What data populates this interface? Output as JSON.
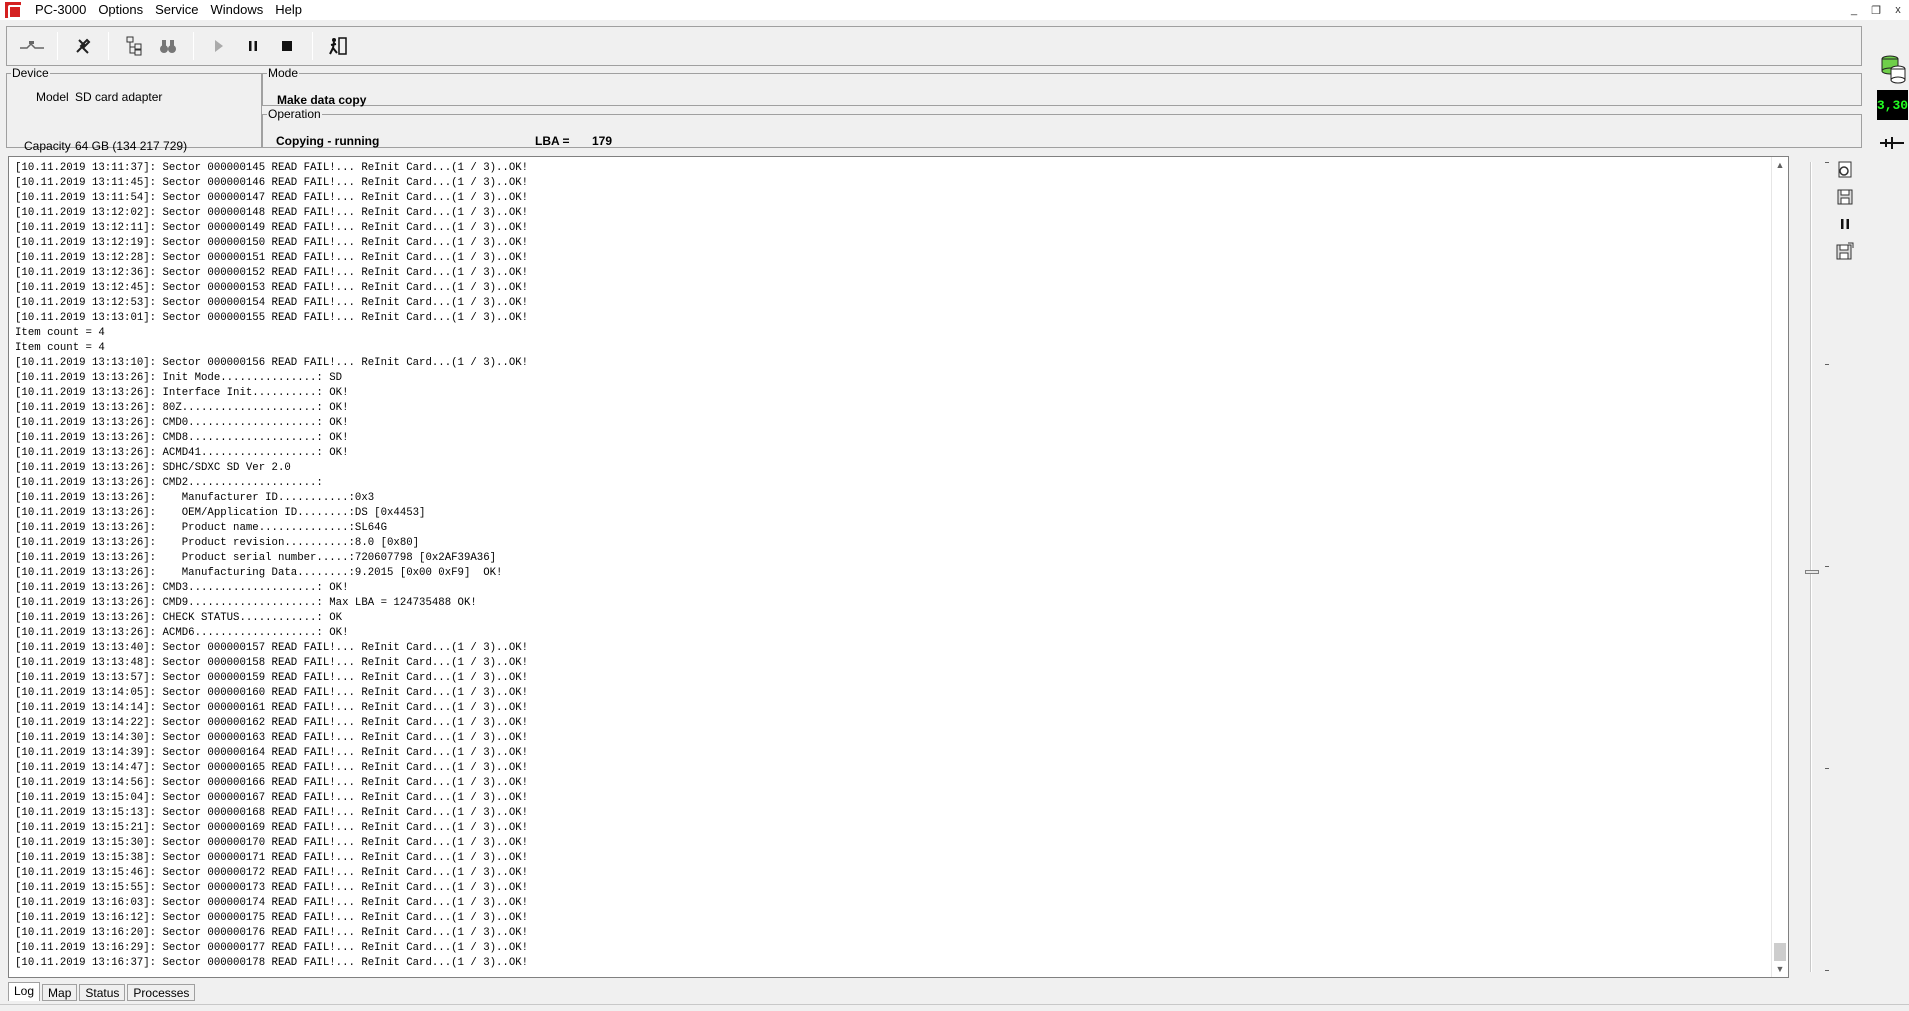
{
  "app": {
    "title": "PC-3000",
    "menus": [
      "Options",
      "Service",
      "Windows",
      "Help"
    ]
  },
  "window_controls": {
    "minimize": "_",
    "restore": "❐",
    "close": "x"
  },
  "toolbar": {
    "icons": [
      "connect-icon",
      "tools-icon",
      "tree-icon",
      "binoculars-icon",
      "play-icon",
      "pause-icon",
      "stop-icon",
      "exit-icon"
    ]
  },
  "device": {
    "legend": "Device",
    "model_label": "Model",
    "model_value": "SD card adapter",
    "capacity_label": "Capacity",
    "capacity_value": "64 GB (134 217 729)"
  },
  "mode": {
    "legend": "Mode",
    "value": "Make data copy"
  },
  "operation": {
    "legend": "Operation",
    "status": "Copying - running",
    "lba_label": "LBA =",
    "lba_value": "179"
  },
  "side_counter": "3,30",
  "log": {
    "lines": [
      "[10.11.2019 13:11:37]: Sector 000000145 READ FAIL!... ReInit Card...(1 / 3)..OK!",
      "[10.11.2019 13:11:45]: Sector 000000146 READ FAIL!... ReInit Card...(1 / 3)..OK!",
      "[10.11.2019 13:11:54]: Sector 000000147 READ FAIL!... ReInit Card...(1 / 3)..OK!",
      "[10.11.2019 13:12:02]: Sector 000000148 READ FAIL!... ReInit Card...(1 / 3)..OK!",
      "[10.11.2019 13:12:11]: Sector 000000149 READ FAIL!... ReInit Card...(1 / 3)..OK!",
      "[10.11.2019 13:12:19]: Sector 000000150 READ FAIL!... ReInit Card...(1 / 3)..OK!",
      "[10.11.2019 13:12:28]: Sector 000000151 READ FAIL!... ReInit Card...(1 / 3)..OK!",
      "[10.11.2019 13:12:36]: Sector 000000152 READ FAIL!... ReInit Card...(1 / 3)..OK!",
      "[10.11.2019 13:12:45]: Sector 000000153 READ FAIL!... ReInit Card...(1 / 3)..OK!",
      "[10.11.2019 13:12:53]: Sector 000000154 READ FAIL!... ReInit Card...(1 / 3)..OK!",
      "[10.11.2019 13:13:01]: Sector 000000155 READ FAIL!... ReInit Card...(1 / 3)..OK!",
      "Item count = 4",
      "Item count = 4",
      "[10.11.2019 13:13:10]: Sector 000000156 READ FAIL!... ReInit Card...(1 / 3)..OK!",
      "[10.11.2019 13:13:26]: Init Mode...............: SD",
      "[10.11.2019 13:13:26]: Interface Init..........: OK!",
      "[10.11.2019 13:13:26]: 80Z.....................: OK!",
      "[10.11.2019 13:13:26]: CMD0....................: OK!",
      "[10.11.2019 13:13:26]: CMD8....................: OK!",
      "[10.11.2019 13:13:26]: ACMD41..................: OK!",
      "[10.11.2019 13:13:26]: SDHC/SDXC SD Ver 2.0",
      "[10.11.2019 13:13:26]: CMD2....................:",
      "[10.11.2019 13:13:26]:    Manufacturer ID...........:0x3",
      "[10.11.2019 13:13:26]:    OEM/Application ID........:DS [0x4453]",
      "[10.11.2019 13:13:26]:    Product name..............:SL64G",
      "[10.11.2019 13:13:26]:    Product revision..........:8.0 [0x80]",
      "[10.11.2019 13:13:26]:    Product serial number.....:720607798 [0x2AF39A36]",
      "[10.11.2019 13:13:26]:    Manufacturing Data........:9.2015 [0x00 0xF9]  OK!",
      "[10.11.2019 13:13:26]: CMD3....................: OK!",
      "[10.11.2019 13:13:26]: CMD9....................: Max LBA = 124735488 OK!",
      "[10.11.2019 13:13:26]: CHECK STATUS............: OK",
      "[10.11.2019 13:13:26]: ACMD6...................: OK!",
      "[10.11.2019 13:13:40]: Sector 000000157 READ FAIL!... ReInit Card...(1 / 3)..OK!",
      "[10.11.2019 13:13:48]: Sector 000000158 READ FAIL!... ReInit Card...(1 / 3)..OK!",
      "[10.11.2019 13:13:57]: Sector 000000159 READ FAIL!... ReInit Card...(1 / 3)..OK!",
      "[10.11.2019 13:14:05]: Sector 000000160 READ FAIL!... ReInit Card...(1 / 3)..OK!",
      "[10.11.2019 13:14:14]: Sector 000000161 READ FAIL!... ReInit Card...(1 / 3)..OK!",
      "[10.11.2019 13:14:22]: Sector 000000162 READ FAIL!... ReInit Card...(1 / 3)..OK!",
      "[10.11.2019 13:14:30]: Sector 000000163 READ FAIL!... ReInit Card...(1 / 3)..OK!",
      "[10.11.2019 13:14:39]: Sector 000000164 READ FAIL!... ReInit Card...(1 / 3)..OK!",
      "[10.11.2019 13:14:47]: Sector 000000165 READ FAIL!... ReInit Card...(1 / 3)..OK!",
      "[10.11.2019 13:14:56]: Sector 000000166 READ FAIL!... ReInit Card...(1 / 3)..OK!",
      "[10.11.2019 13:15:04]: Sector 000000167 READ FAIL!... ReInit Card...(1 / 3)..OK!",
      "[10.11.2019 13:15:13]: Sector 000000168 READ FAIL!... ReInit Card...(1 / 3)..OK!",
      "[10.11.2019 13:15:21]: Sector 000000169 READ FAIL!... ReInit Card...(1 / 3)..OK!",
      "[10.11.2019 13:15:30]: Sector 000000170 READ FAIL!... ReInit Card...(1 / 3)..OK!",
      "[10.11.2019 13:15:38]: Sector 000000171 READ FAIL!... ReInit Card...(1 / 3)..OK!",
      "[10.11.2019 13:15:46]: Sector 000000172 READ FAIL!... ReInit Card...(1 / 3)..OK!",
      "[10.11.2019 13:15:55]: Sector 000000173 READ FAIL!... ReInit Card...(1 / 3)..OK!",
      "[10.11.2019 13:16:03]: Sector 000000174 READ FAIL!... ReInit Card...(1 / 3)..OK!",
      "[10.11.2019 13:16:12]: Sector 000000175 READ FAIL!... ReInit Card...(1 / 3)..OK!",
      "[10.11.2019 13:16:20]: Sector 000000176 READ FAIL!... ReInit Card...(1 / 3)..OK!",
      "[10.11.2019 13:16:29]: Sector 000000177 READ FAIL!... ReInit Card...(1 / 3)..OK!",
      "[10.11.2019 13:16:37]: Sector 000000178 READ FAIL!... ReInit Card...(1 / 3)..OK!"
    ]
  },
  "log_side_icons": [
    "settings-doc-icon",
    "save-icon",
    "pause-icon",
    "save-as-icon"
  ],
  "tabs": [
    {
      "label": "Log",
      "active": true
    },
    {
      "label": "Map",
      "active": false
    },
    {
      "label": "Status",
      "active": false
    },
    {
      "label": "Processes",
      "active": false
    }
  ],
  "colors": {
    "app_logo": "#d42020",
    "counter_text": "#22ff22",
    "counter_bg": "#000000"
  }
}
